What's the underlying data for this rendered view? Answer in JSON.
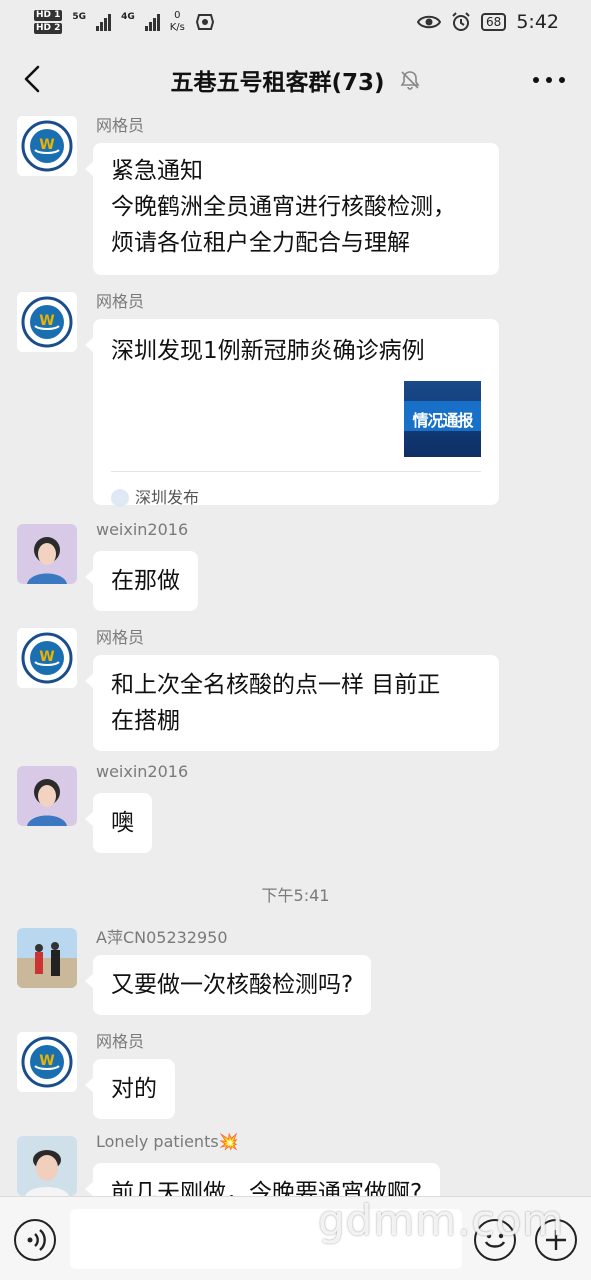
{
  "status_bar": {
    "hd1": "HD 1",
    "hd2": "HD 2",
    "net1": "5G",
    "net2": "4G",
    "speed_value": "0",
    "speed_unit": "K/s",
    "battery": "68",
    "time": "5:42"
  },
  "header": {
    "title": "五巷五号租客群(73)"
  },
  "messages": [
    {
      "sender": "网格员",
      "lines": [
        "紧急通知",
        "今晚鹤洲全员通宵进行核酸检测，",
        "烦请各位租户全力配合与理解"
      ]
    },
    {
      "sender": "网格员",
      "link_title": "深圳发现1例新冠肺炎确诊病例",
      "thumb_text": "情况通报",
      "source": "深圳发布"
    },
    {
      "sender": "weixin2016",
      "text": "在那做"
    },
    {
      "sender": "网格员",
      "lines": [
        "和上次全名核酸的点一样 目前正",
        "在搭棚"
      ]
    },
    {
      "sender": "weixin2016",
      "text": "噢"
    },
    {
      "sender": "A萍CN05232950",
      "text": "又要做一次核酸检测吗?"
    },
    {
      "sender": "网格员",
      "text": "对的"
    },
    {
      "sender": "Lonely patients💥",
      "text": "前几天刚做，今晚要通宵做啊?"
    }
  ],
  "timestamp": "下午5:41",
  "watermark": "gdmm.com",
  "icons": {
    "back": "chevron-left-icon",
    "mute": "bell-off-icon",
    "more": "more-dots-icon",
    "voice": "voice-icon",
    "emoji": "emoji-icon",
    "plus": "plus-icon"
  },
  "colors": {
    "background": "#ededed",
    "bubble": "#ffffff",
    "sender_text": "#7a7a7a"
  }
}
